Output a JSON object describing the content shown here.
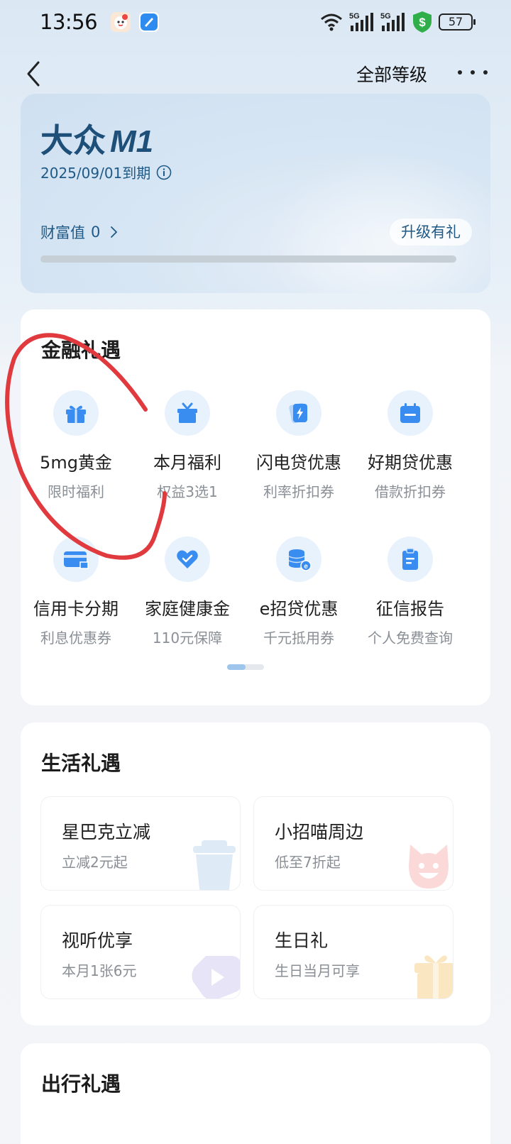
{
  "status_bar": {
    "time": "13:56",
    "battery": "57",
    "icons": [
      "wifi-icon",
      "signal-5g-icon",
      "signal-5g-icon",
      "shield-dollar-icon",
      "battery-icon"
    ]
  },
  "nav": {
    "back_icon": "chevron-left-icon",
    "all_levels": "全部等级",
    "more_icon": "more-dots-icon"
  },
  "member_card": {
    "level_cn": "大众",
    "level_code": "M1",
    "expire": "2025/09/01到期",
    "info_icon": "info-icon",
    "wealth_label": "财富值",
    "wealth_value": "0",
    "upgrade_button": "升级有礼",
    "progress_fraction": 0.0
  },
  "finance": {
    "title": "金融礼遇",
    "items": [
      {
        "name": "5mg黄金",
        "sub": "限时福利",
        "icon": "gift-icon"
      },
      {
        "name": "本月福利",
        "sub": "权益3选1",
        "icon": "gift-box-icon"
      },
      {
        "name": "闪电贷优惠",
        "sub": "利率折扣券",
        "icon": "lightning-icon"
      },
      {
        "name": "好期贷优惠",
        "sub": "借款折扣券",
        "icon": "calendar-icon"
      },
      {
        "name": "信用卡分期",
        "sub": "利息优惠券",
        "icon": "credit-card-icon"
      },
      {
        "name": "家庭健康金",
        "sub": "110元保障",
        "icon": "heart-check-icon"
      },
      {
        "name": "e招贷优惠",
        "sub": "千元抵用券",
        "icon": "coins-icon"
      },
      {
        "name": "征信报告",
        "sub": "个人免费查询",
        "icon": "clipboard-icon"
      }
    ],
    "page_index": 1,
    "page_count": 2
  },
  "life": {
    "title": "生活礼遇",
    "items": [
      {
        "name": "星巴克立减",
        "sub": "立减2元起",
        "icon": "cup-icon"
      },
      {
        "name": "小招喵周边",
        "sub": "低至7折起",
        "icon": "cat-icon"
      },
      {
        "name": "视听优享",
        "sub": "本月1张6元",
        "icon": "play-icon"
      },
      {
        "name": "生日礼",
        "sub": "生日当月可享",
        "icon": "birthday-gift-icon"
      }
    ]
  },
  "travel": {
    "title": "出行礼遇"
  },
  "colors": {
    "accent": "#3a8df0",
    "icon_bg": "#e8f2fd",
    "card_text": "#1f5a87",
    "annotation": "#e0393e"
  }
}
